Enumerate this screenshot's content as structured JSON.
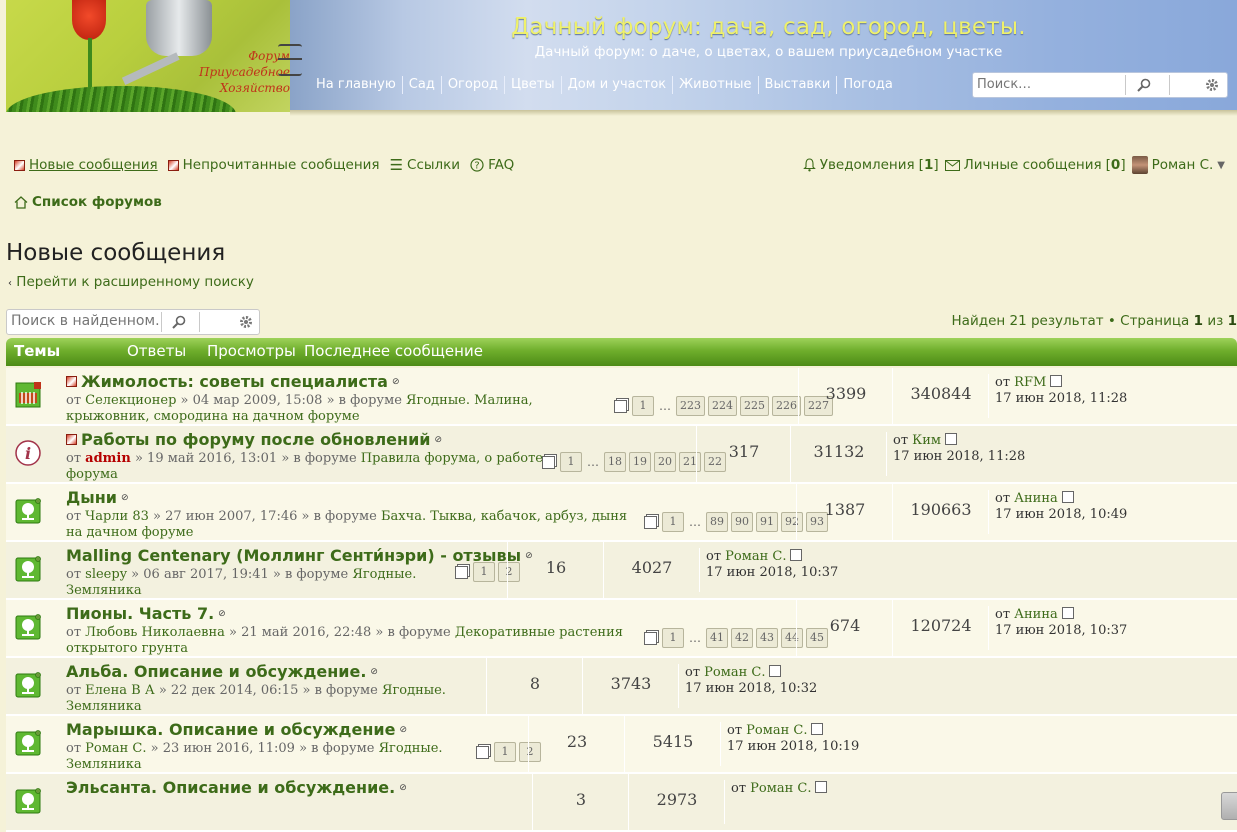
{
  "site": {
    "title": "Дачный форум: дача, сад, огород, цветы.",
    "subtitle": "Дачный форум: о даче, о цветах, о вашем приусадебном участке",
    "logo_lines": [
      "Форум",
      "Приусадебное",
      "Хозяйство"
    ]
  },
  "nav": [
    "На главную",
    "Сад",
    "Огород",
    "Цветы",
    "Дом и участок",
    "Животные",
    "Выставки",
    "Погода"
  ],
  "header_search": {
    "placeholder": "Поиск…"
  },
  "userbar": {
    "new_posts": "Новые сообщения",
    "unread_posts": "Непрочитанные сообщения",
    "links": "Ссылки",
    "faq": "FAQ",
    "notifications_label": "Уведомления",
    "notifications_count": "1",
    "messages_label": "Личные сообщения",
    "messages_count": "0",
    "user_name": "Роман С."
  },
  "breadcrumb": "Список форумов",
  "page_title": "Новые сообщения",
  "advanced_search": "Перейти к расширенному поиску",
  "result_search": {
    "placeholder": "Поиск в найденном…"
  },
  "pagination": {
    "found": "Найден 21 результат",
    "page_word": "Страница",
    "current": "1",
    "of_word": "из",
    "total": "1"
  },
  "columns": {
    "topics": "Темы",
    "replies": "Ответы",
    "views": "Просмотры",
    "last_post": "Последнее сообщение"
  },
  "colors": {
    "accent": "#3d6b19",
    "header_green": "#6fae2c",
    "title_yellow": "#eff16a"
  },
  "topics": [
    {
      "icon": "fence-icon",
      "mini": true,
      "title": "Жимолость: советы специалиста",
      "author": "Селекционер",
      "date": "04 мар 2009, 15:08",
      "forum": "Ягодные. Малина, крыжовник, смородина на дачном форуме",
      "pages": [
        "1",
        "…",
        "223",
        "224",
        "225",
        "226",
        "227"
      ],
      "replies": "3399",
      "views": "340844",
      "last_author": "RFM",
      "last_date": "17 июн 2018, 11:28"
    },
    {
      "icon": "info-icon",
      "mini": true,
      "title": "Работы по форуму после обновлений",
      "author": "admin",
      "admin": true,
      "date": "19 май 2016, 13:01",
      "forum": "Правила форума, о работе форума",
      "pages": [
        "1",
        "…",
        "18",
        "19",
        "20",
        "21",
        "22"
      ],
      "replies": "317",
      "views": "31132",
      "last_author": "Ким",
      "last_date": "17 июн 2018, 11:28"
    },
    {
      "icon": "tree-icon",
      "mini": false,
      "title": "Дыни",
      "author": "Чарли 83",
      "date": "27 июн 2007, 17:46",
      "forum": "Бахча. Тыква, кабачок, арбуз, дыня на дачном форуме",
      "pages": [
        "1",
        "…",
        "89",
        "90",
        "91",
        "92",
        "93"
      ],
      "replies": "1387",
      "views": "190663",
      "last_author": "Анина",
      "last_date": "17 июн 2018, 10:49"
    },
    {
      "icon": "tree-icon",
      "mini": false,
      "title": "Malling Centenary (Моллинг Сенти́нэри) - отзывы",
      "author": "sleepy",
      "date": "06 авг 2017, 19:41",
      "forum": "Ягодные. Земляника",
      "pages": [
        "1",
        "2"
      ],
      "replies": "16",
      "views": "4027",
      "last_author": "Роман С.",
      "last_date": "17 июн 2018, 10:37"
    },
    {
      "icon": "tree-icon",
      "mini": false,
      "title": "Пионы. Часть 7.",
      "author": "Любовь Николаевна",
      "date": "21 май 2016, 22:48",
      "forum": "Декоративные растения открытого грунта",
      "pages": [
        "1",
        "…",
        "41",
        "42",
        "43",
        "44",
        "45"
      ],
      "replies": "674",
      "views": "120724",
      "last_author": "Анина",
      "last_date": "17 июн 2018, 10:37"
    },
    {
      "icon": "tree-icon",
      "mini": false,
      "title": "Альба. Описание и обсуждение.",
      "author": "Елена В А",
      "date": "22 дек 2014, 06:15",
      "forum": "Ягодные. Земляника",
      "pages": [],
      "replies": "8",
      "views": "3743",
      "last_author": "Роман С.",
      "last_date": "17 июн 2018, 10:32"
    },
    {
      "icon": "tree-icon",
      "mini": false,
      "title": "Марышка. Описание и обсуждение",
      "author": "Роман С.",
      "date": "23 июн 2016, 11:09",
      "forum": "Ягодные. Земляника",
      "pages": [
        "1",
        "2"
      ],
      "replies": "23",
      "views": "5415",
      "last_author": "Роман С.",
      "last_date": "17 июн 2018, 10:19"
    },
    {
      "icon": "tree-icon",
      "mini": false,
      "title": "Эльсанта. Описание и обсуждение.",
      "author": "",
      "date": "",
      "forum": "",
      "pages": [],
      "replies": "3",
      "views": "2973",
      "last_author": "Роман С.",
      "last_date": ""
    }
  ]
}
